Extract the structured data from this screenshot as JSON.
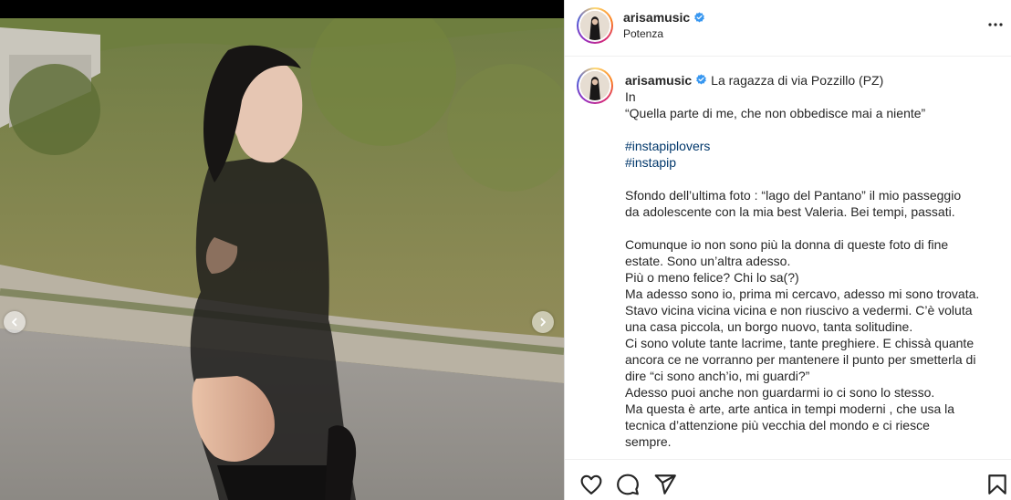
{
  "post": {
    "username": "arisamusic",
    "location": "Potenza"
  },
  "caption": {
    "username": "arisamusic",
    "first_line": "La ragazza di via Pozzillo (PZ)",
    "lines": [
      {
        "text": "In",
        "type": "text"
      },
      {
        "text": "“Quella parte di me, che non obbedisce mai a niente”",
        "type": "text"
      },
      {
        "text": "",
        "type": "blank"
      },
      {
        "text": "#instapiplovers",
        "type": "hashtag"
      },
      {
        "text": "#instapip",
        "type": "hashtag"
      },
      {
        "text": "",
        "type": "blank"
      },
      {
        "text": "Sfondo dell’ultima foto : “lago del Pantano” il mio passeggio",
        "type": "text"
      },
      {
        "text": "da adolescente con la mia best Valeria. Bei tempi, passati.",
        "type": "text"
      },
      {
        "text": "",
        "type": "blank"
      },
      {
        "text": "Comunque io non sono più la donna di queste foto di fine",
        "type": "text"
      },
      {
        "text": "estate. Sono un’altra adesso.",
        "type": "text"
      },
      {
        "text": "Più o meno felice? Chi lo sa(?)",
        "type": "text"
      },
      {
        "text": "Ma adesso sono io, prima mi cercavo, adesso mi sono trovata.",
        "type": "text"
      },
      {
        "text": "Stavo vicina vicina vicina e non riuscivo a vedermi. C’è voluta",
        "type": "text"
      },
      {
        "text": "una casa piccola, un borgo nuovo, tanta solitudine.",
        "type": "text"
      },
      {
        "text": "Ci sono volute tante lacrime, tante preghiere. E chissà quante",
        "type": "text"
      },
      {
        "text": "ancora ce ne vorranno per mantenere il punto per smetterla di",
        "type": "text"
      },
      {
        "text": "dire “ci sono anch’io, mi guardi?”",
        "type": "text"
      },
      {
        "text": "Adesso puoi anche non guardarmi io ci sono lo stesso.",
        "type": "text"
      },
      {
        "text": "Ma questa è arte, arte antica in tempi moderni , che usa la",
        "type": "text"
      },
      {
        "text": "tecnica d’attenzione più vecchia del mondo e ci riesce",
        "type": "text"
      },
      {
        "text": "sempre.",
        "type": "text"
      }
    ]
  },
  "icons": {
    "more": "more-horizontal-icon",
    "verified": "verified-badge-icon",
    "like": "heart-icon",
    "comment": "comment-icon",
    "share": "send-icon",
    "save": "bookmark-icon",
    "prev": "chevron-left-icon",
    "next": "chevron-right-icon"
  },
  "colors": {
    "verified": "#3897f0",
    "hashtag": "#00376b",
    "text": "#262626"
  }
}
